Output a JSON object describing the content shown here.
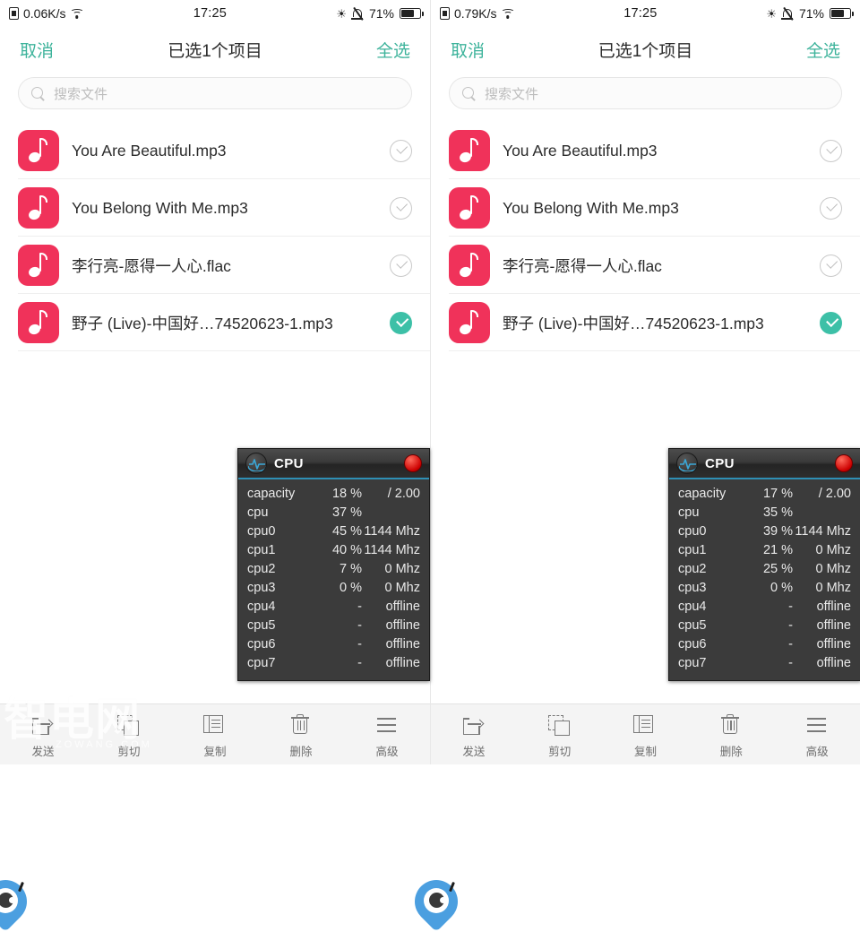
{
  "panels": [
    {
      "status_bar": {
        "network_speed": "0.06K/s",
        "time": "17:25",
        "battery_percent": "71%",
        "icons": [
          "sim-card-icon",
          "wifi-icon",
          "bluetooth-icon",
          "mute-icon",
          "battery-icon"
        ]
      },
      "nav": {
        "cancel": "取消",
        "title": "已选1个项目",
        "select_all": "全选"
      },
      "search": {
        "placeholder": "搜索文件"
      },
      "files": [
        {
          "name": "You Are Beautiful.mp3",
          "selected": false
        },
        {
          "name": "You Belong With Me.mp3",
          "selected": false
        },
        {
          "name": "李行亮-愿得一人心.flac",
          "selected": false
        },
        {
          "name": "野子 (Live)-中国好…74520623-1.mp3",
          "selected": true
        }
      ],
      "cpu_widget": {
        "title": "CPU",
        "rows": [
          {
            "label": "capacity",
            "value": "18 %",
            "extra": "/ 2.00"
          },
          {
            "label": "cpu",
            "value": "37 %",
            "extra": ""
          },
          {
            "label": "cpu0",
            "value": "45 %",
            "extra": "1144 Mhz"
          },
          {
            "label": "cpu1",
            "value": "40 %",
            "extra": "1144 Mhz"
          },
          {
            "label": "cpu2",
            "value": "7 %",
            "extra": "0 Mhz"
          },
          {
            "label": "cpu3",
            "value": "0 %",
            "extra": "0 Mhz"
          },
          {
            "label": "cpu4",
            "value": "-",
            "extra": "offline"
          },
          {
            "label": "cpu5",
            "value": "-",
            "extra": "offline"
          },
          {
            "label": "cpu6",
            "value": "-",
            "extra": "offline"
          },
          {
            "label": "cpu7",
            "value": "-",
            "extra": "offline"
          }
        ]
      },
      "toolbar": [
        {
          "label": "发送",
          "icon": "send-icon"
        },
        {
          "label": "剪切",
          "icon": "cut-icon"
        },
        {
          "label": "复制",
          "icon": "copy-icon"
        },
        {
          "label": "删除",
          "icon": "trash-icon"
        },
        {
          "label": "高级",
          "icon": "menu-icon"
        }
      ]
    },
    {
      "status_bar": {
        "network_speed": "0.79K/s",
        "time": "17:25",
        "battery_percent": "71%",
        "icons": [
          "sim-card-icon",
          "wifi-icon",
          "bluetooth-icon",
          "mute-icon",
          "battery-icon"
        ]
      },
      "nav": {
        "cancel": "取消",
        "title": "已选1个项目",
        "select_all": "全选"
      },
      "search": {
        "placeholder": "搜索文件"
      },
      "files": [
        {
          "name": "You Are Beautiful.mp3",
          "selected": false
        },
        {
          "name": "You Belong With Me.mp3",
          "selected": false
        },
        {
          "name": "李行亮-愿得一人心.flac",
          "selected": false
        },
        {
          "name": "野子 (Live)-中国好…74520623-1.mp3",
          "selected": true
        }
      ],
      "cpu_widget": {
        "title": "CPU",
        "rows": [
          {
            "label": "capacity",
            "value": "17 %",
            "extra": "/ 2.00"
          },
          {
            "label": "cpu",
            "value": "35 %",
            "extra": ""
          },
          {
            "label": "cpu0",
            "value": "39 %",
            "extra": "1144 Mhz"
          },
          {
            "label": "cpu1",
            "value": "21 %",
            "extra": "0 Mhz"
          },
          {
            "label": "cpu2",
            "value": "25 %",
            "extra": "0 Mhz"
          },
          {
            "label": "cpu3",
            "value": "0 %",
            "extra": "0 Mhz"
          },
          {
            "label": "cpu4",
            "value": "-",
            "extra": "offline"
          },
          {
            "label": "cpu5",
            "value": "-",
            "extra": "offline"
          },
          {
            "label": "cpu6",
            "value": "-",
            "extra": "offline"
          },
          {
            "label": "cpu7",
            "value": "-",
            "extra": "offline"
          }
        ]
      },
      "toolbar": [
        {
          "label": "发送",
          "icon": "send-icon"
        },
        {
          "label": "剪切",
          "icon": "cut-icon"
        },
        {
          "label": "复制",
          "icon": "copy-icon"
        },
        {
          "label": "删除",
          "icon": "trash-icon"
        },
        {
          "label": "高级",
          "icon": "menu-icon"
        }
      ]
    }
  ],
  "watermark": {
    "text": "智电网",
    "sub": "ZOWANG.COM"
  },
  "colors": {
    "accent_teal": "#3db39b",
    "selected_teal": "#3dc0a7",
    "music_pink": "#f0325a",
    "bubble_blue": "#4b9fe0",
    "cpu_close_red": "#cc0000"
  }
}
